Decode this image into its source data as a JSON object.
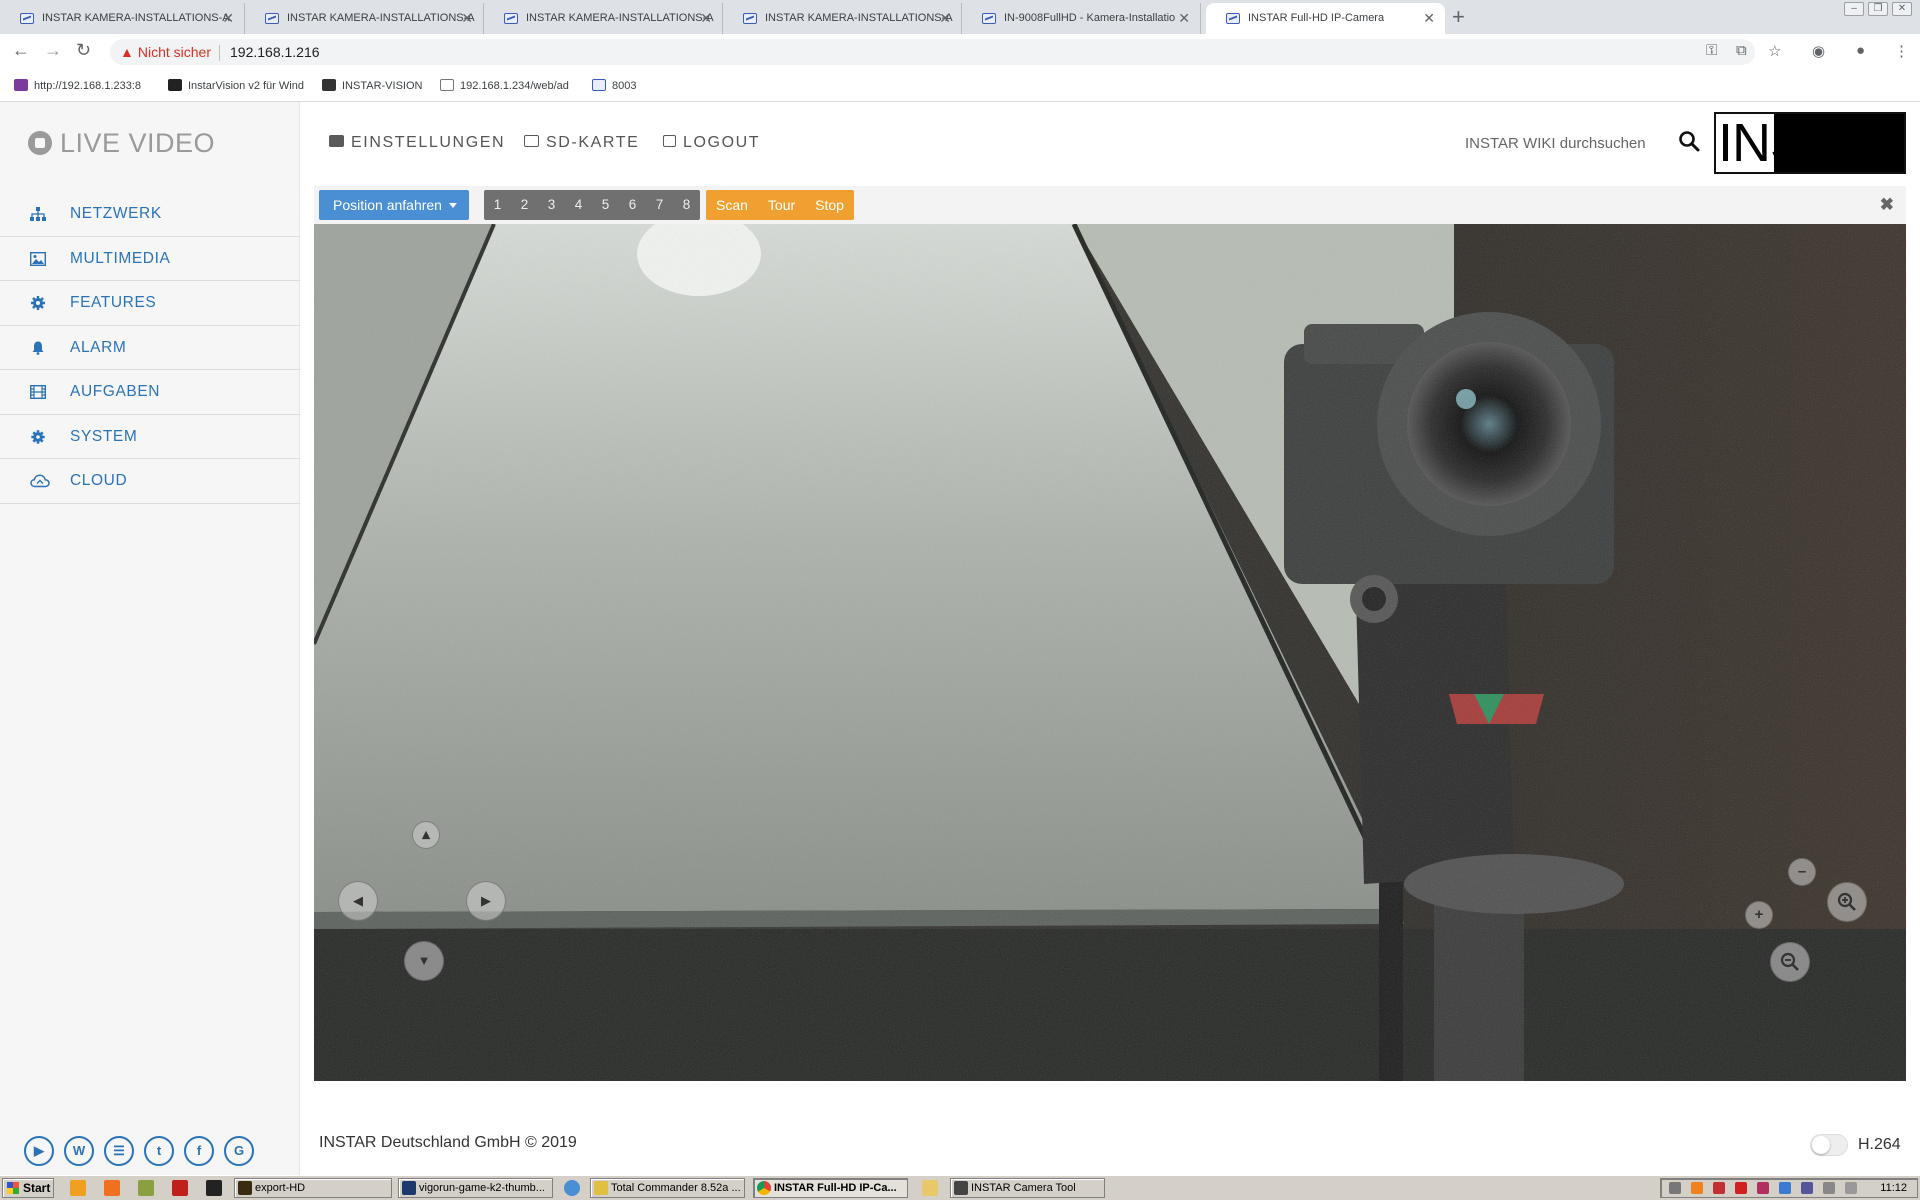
{
  "browser": {
    "tabs": [
      {
        "title": "INSTAR KAMERA-INSTALLATIONS-A"
      },
      {
        "title": "INSTAR KAMERA-INSTALLATIONS-A"
      },
      {
        "title": "INSTAR KAMERA-INSTALLATIONS-A"
      },
      {
        "title": "INSTAR KAMERA-INSTALLATIONS-A"
      },
      {
        "title": "IN-9008FullHD - Kamera-Installatio"
      },
      {
        "title": "INSTAR Full-HD IP-Camera"
      }
    ],
    "security_label": "Nicht sicher",
    "url": "192.168.1.216",
    "bookmarks": [
      {
        "label": "http://192.168.1.233:8"
      },
      {
        "label": "InstarVision v2 für Wind"
      },
      {
        "label": "INSTAR-VISION"
      },
      {
        "label": "192.168.1.234/web/ad"
      },
      {
        "label": "8003"
      }
    ]
  },
  "sidebar": {
    "brand": "LIVE VIDEO",
    "items": [
      {
        "label": "NETZWERK",
        "icon": "sitemap-icon"
      },
      {
        "label": "MULTIMEDIA",
        "icon": "image-icon"
      },
      {
        "label": "FEATURES",
        "icon": "gear-icon"
      },
      {
        "label": "ALARM",
        "icon": "bell-icon"
      },
      {
        "label": "AUFGABEN",
        "icon": "film-icon"
      },
      {
        "label": "SYSTEM",
        "icon": "cog-icon"
      },
      {
        "label": "CLOUD",
        "icon": "cloud-icon"
      }
    ],
    "social": [
      "youtube-icon",
      "wiki-icon",
      "forum-icon",
      "twitter-icon",
      "facebook-icon",
      "google-plus-icon"
    ]
  },
  "topnav": {
    "einstellungen": "EINSTELLUNGEN",
    "sdkarte": "SD-KARTE",
    "logout": "LOGOUT",
    "wiki_search": "INSTAR WIKI durchsuchen",
    "logo": "INSTAR"
  },
  "ptz": {
    "position_button": "Position anfahren",
    "presets": [
      "1",
      "2",
      "3",
      "4",
      "5",
      "6",
      "7",
      "8"
    ],
    "scan": "Scan",
    "tour": "Tour",
    "stop": "Stop"
  },
  "footer": {
    "copyright": "INSTAR Deutschland GmbH © 2019",
    "codec": "H.264"
  },
  "taskbar": {
    "start": "Start",
    "buttons": [
      {
        "label": "export-HD"
      },
      {
        "label": "vigorun-game-k2-thumb..."
      },
      {
        "label": "Total Commander 8.52a ..."
      },
      {
        "label": "INSTAR Full-HD IP-Ca..."
      },
      {
        "label": "INSTAR Camera Tool"
      }
    ],
    "clock": "11:12"
  },
  "colors": {
    "accent_blue": "#2b73b7",
    "button_blue": "#4a8ed4",
    "preset_gray": "#707070",
    "tour_orange": "#f0a030"
  }
}
